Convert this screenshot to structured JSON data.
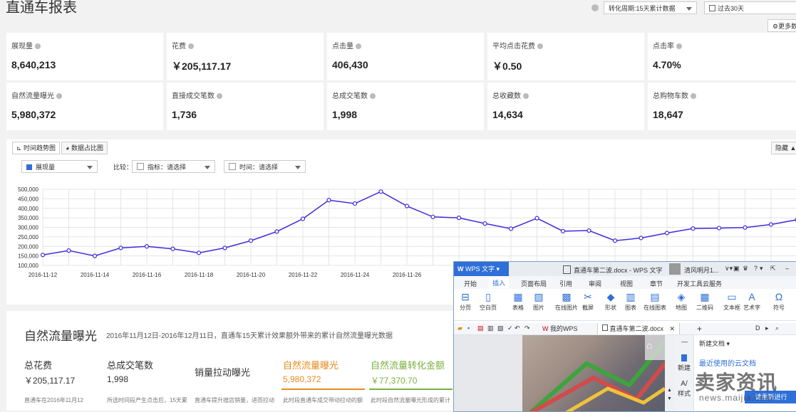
{
  "page": {
    "title": "直通车报表",
    "conversion_label": "转化周期:15天累计数据",
    "date_range": "过去30天",
    "more_button": "更多数"
  },
  "metrics": [
    {
      "label": "展现量",
      "value": "8,640,213"
    },
    {
      "label": "花费",
      "value": "￥205,117.17"
    },
    {
      "label": "点击量",
      "value": "406,430"
    },
    {
      "label": "平均点击花费",
      "value": "￥0.50"
    },
    {
      "label": "点击率",
      "value": "4.70%"
    },
    {
      "label": "自然流量曝光",
      "value": "5,980,372"
    },
    {
      "label": "直接成交笔数",
      "value": "1,736"
    },
    {
      "label": "总成交笔数",
      "value": "1,998"
    },
    {
      "label": "总收藏数",
      "value": "14,634"
    },
    {
      "label": "总购物车数",
      "value": "18,647"
    }
  ],
  "trend": {
    "tab_trend": "时间趋势图",
    "tab_share": "数据占比图",
    "hide": "隐藏",
    "metric_select": "展现量",
    "compare_label": "比较：",
    "indicator_select": "指标：请选择",
    "time_select": "时间：请选择"
  },
  "chart_data": {
    "type": "line",
    "title": "",
    "xlabel": "",
    "ylabel": "",
    "ylim": [
      100000,
      500000
    ],
    "yticks": [
      "500,000",
      "450,000",
      "400,000",
      "350,000",
      "300,000",
      "250,000",
      "200,000",
      "150,000",
      "100,000"
    ],
    "xticks": [
      "2016-11-12",
      "2016-11-14",
      "2016-11-16",
      "2016-11-18",
      "2016-11-20",
      "2016-11-22",
      "2016-11-24",
      "2016-11-26"
    ],
    "x": [
      "2016-11-12",
      "2016-11-13",
      "2016-11-14",
      "2016-11-15",
      "2016-11-16",
      "2016-11-17",
      "2016-11-18",
      "2016-11-19",
      "2016-11-20",
      "2016-11-21",
      "2016-11-22",
      "2016-11-23",
      "2016-11-24",
      "2016-11-25",
      "2016-11-26",
      "2016-11-27",
      "2016-11-28",
      "2016-11-29",
      "2016-11-30",
      "2016-12-01",
      "2016-12-02",
      "2016-12-03",
      "2016-12-04",
      "2016-12-05",
      "2016-12-06",
      "2016-12-07",
      "2016-12-08",
      "2016-12-09",
      "2016-12-10",
      "2016-12-11"
    ],
    "values": [
      155000,
      178000,
      150000,
      192000,
      200000,
      187000,
      166000,
      192000,
      230000,
      278000,
      345000,
      443000,
      425000,
      488000,
      412000,
      355000,
      350000,
      320000,
      293000,
      348000,
      280000,
      283000,
      230000,
      244000,
      270000,
      294000,
      296000,
      299000,
      315000,
      340000
    ],
    "color": "#3c2ddc",
    "grid": true
  },
  "natural": {
    "title": "自然流量曝光",
    "subtitle": "2016年11月12日-2016年12月11日，直通车15天累计效果额外带来的累计自然流量曝光数据",
    "stats": [
      {
        "label": "总花费",
        "value": "￥205,117.17"
      },
      {
        "label": "总成交笔数",
        "value": "1,998"
      },
      {
        "label": "销量拉动曝光",
        "value": ""
      },
      {
        "label": "自然流量曝光",
        "value": "5,980,372"
      },
      {
        "label": "自然流量转化金额",
        "value": "￥77,370.70"
      }
    ],
    "notes": [
      "直通车在2016年11月12",
      "所选时间段产生点击后，15天累",
      "直通车提升搜店销量，进而拉动",
      "此时段直通车成交带动拉动的额",
      "此时段自然流量曝光形成的累计"
    ]
  },
  "wps": {
    "app_name": "WPS 文字",
    "doc_title": "直通车第二波.docx - WPS 文字",
    "user": "清风明月1...",
    "ribbon_tabs": [
      "开始",
      "插入",
      "页面布局",
      "引用",
      "审阅",
      "视图",
      "章节",
      "开发工具",
      "云服务"
    ],
    "ribbon_items": [
      "分页",
      "空白页",
      "表格",
      "图片",
      "在线图片",
      "截屏",
      "形状",
      "图表",
      "在线图表",
      "地图",
      "二维码",
      "文本框",
      "艺术字",
      "符号"
    ],
    "doc_tabs": [
      "我的WPS",
      "直通车第二波.docx"
    ],
    "side_new_doc": "新建文档",
    "side_new": "新建",
    "side_style": "样式",
    "recent_cloud": "最近使用的云文档",
    "watermark": "卖家资讯",
    "watermark_url": "news.maijia.com",
    "blue_button": "请重新进行"
  }
}
